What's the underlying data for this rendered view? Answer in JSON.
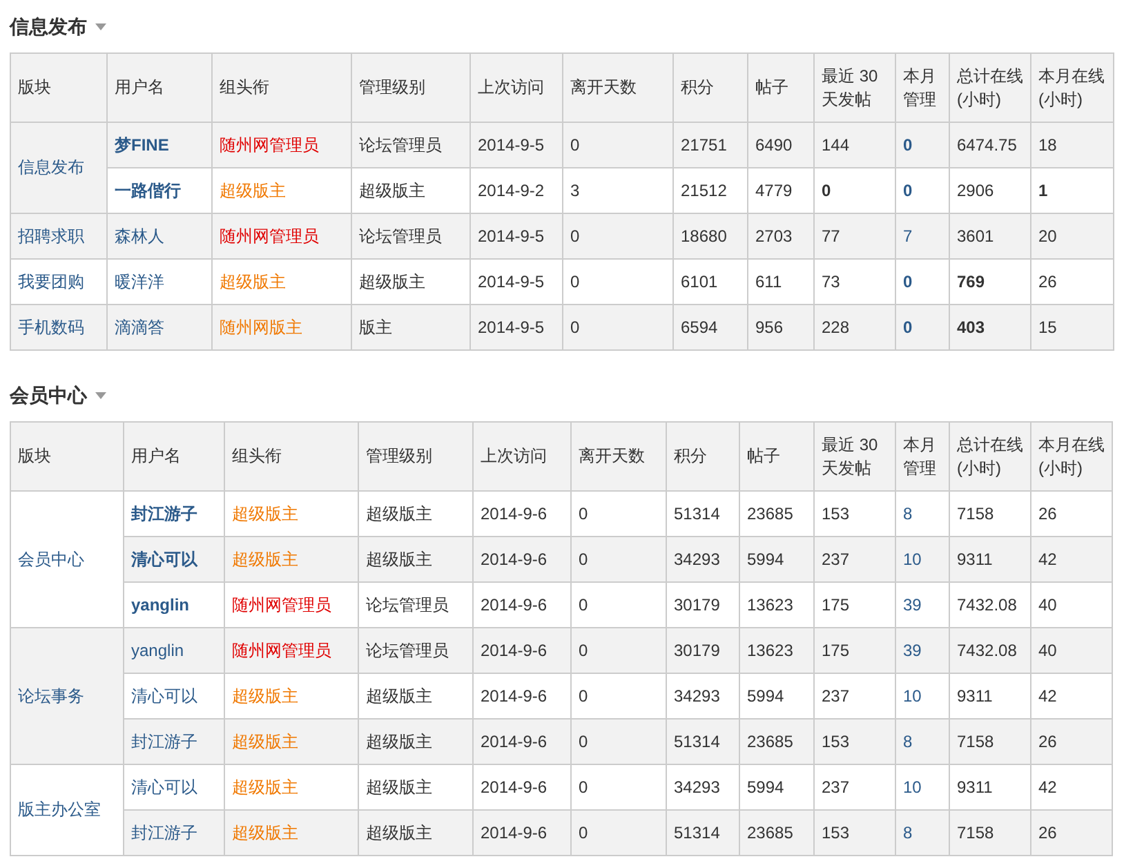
{
  "sections": [
    {
      "title": "信息发布",
      "columns": [
        "版块",
        "用户名",
        "组头衔",
        "管理级别",
        "上次访问",
        "离开天数",
        "积分",
        "帖子",
        "最近 30 天发帖",
        "本月管理",
        "总计在线(小时)",
        "本月在线(小时)"
      ],
      "groups": [
        {
          "forum": "信息发布",
          "rows": [
            {
              "shaded": true,
              "user": {
                "text": "梦FINE",
                "bold": true
              },
              "title": {
                "text": "随州网管理员",
                "color": "#e00000"
              },
              "level": "论坛管理员",
              "last_visit": "2014-9-5",
              "days_away": "0",
              "points": "21751",
              "posts": "6490",
              "recent_posts": {
                "text": "144",
                "bold": false
              },
              "month_manage": {
                "text": "0",
                "bold": true
              },
              "total_online": {
                "text": "6474.75",
                "bold": false
              },
              "month_online": {
                "text": "18",
                "bold": false
              }
            },
            {
              "shaded": false,
              "user": {
                "text": "一路偕行",
                "bold": true
              },
              "title": {
                "text": "超级版主",
                "color": "#f07800"
              },
              "level": "超级版主",
              "last_visit": "2014-9-2",
              "days_away": "3",
              "points": "21512",
              "posts": "4779",
              "recent_posts": {
                "text": "0",
                "bold": true
              },
              "month_manage": {
                "text": "0",
                "bold": true
              },
              "total_online": {
                "text": "2906",
                "bold": false
              },
              "month_online": {
                "text": "1",
                "bold": true
              }
            }
          ]
        },
        {
          "forum": "招聘求职",
          "rows": [
            {
              "shaded": true,
              "user": {
                "text": "森林人",
                "bold": false
              },
              "title": {
                "text": "随州网管理员",
                "color": "#e00000"
              },
              "level": "论坛管理员",
              "last_visit": "2014-9-5",
              "days_away": "0",
              "points": "18680",
              "posts": "2703",
              "recent_posts": {
                "text": "77",
                "bold": false
              },
              "month_manage": {
                "text": "7",
                "bold": false
              },
              "total_online": {
                "text": "3601",
                "bold": false
              },
              "month_online": {
                "text": "20",
                "bold": false
              }
            }
          ]
        },
        {
          "forum": "我要团购",
          "rows": [
            {
              "shaded": false,
              "user": {
                "text": "暖洋洋",
                "bold": false
              },
              "title": {
                "text": "超级版主",
                "color": "#f07800"
              },
              "level": "超级版主",
              "last_visit": "2014-9-5",
              "days_away": "0",
              "points": "6101",
              "posts": "611",
              "recent_posts": {
                "text": "73",
                "bold": false
              },
              "month_manage": {
                "text": "0",
                "bold": true
              },
              "total_online": {
                "text": "769",
                "bold": true
              },
              "month_online": {
                "text": "26",
                "bold": false
              }
            }
          ]
        },
        {
          "forum": "手机数码",
          "rows": [
            {
              "shaded": true,
              "user": {
                "text": "滴滴答",
                "bold": false
              },
              "title": {
                "text": "随州网版主",
                "color": "#f07800"
              },
              "level": "版主",
              "last_visit": "2014-9-5",
              "days_away": "0",
              "points": "6594",
              "posts": "956",
              "recent_posts": {
                "text": "228",
                "bold": false
              },
              "month_manage": {
                "text": "0",
                "bold": true
              },
              "total_online": {
                "text": "403",
                "bold": true
              },
              "month_online": {
                "text": "15",
                "bold": false
              }
            }
          ]
        }
      ]
    },
    {
      "title": "会员中心",
      "columns": [
        "版块",
        "用户名",
        "组头衔",
        "管理级别",
        "上次访问",
        "离开天数",
        "积分",
        "帖子",
        "最近 30 天发帖",
        "本月管理",
        "总计在线(小时)",
        "本月在线(小时)"
      ],
      "groups": [
        {
          "forum": "会员中心",
          "rows": [
            {
              "shaded": false,
              "user": {
                "text": "封江游子",
                "bold": true
              },
              "title": {
                "text": "超级版主",
                "color": "#f07800"
              },
              "level": "超级版主",
              "last_visit": "2014-9-6",
              "days_away": "0",
              "points": "51314",
              "posts": "23685",
              "recent_posts": {
                "text": "153",
                "bold": false
              },
              "month_manage": {
                "text": "8",
                "bold": false
              },
              "total_online": {
                "text": "7158",
                "bold": false
              },
              "month_online": {
                "text": "26",
                "bold": false
              }
            },
            {
              "shaded": true,
              "user": {
                "text": "清心可以",
                "bold": true
              },
              "title": {
                "text": "超级版主",
                "color": "#f07800"
              },
              "level": "超级版主",
              "last_visit": "2014-9-6",
              "days_away": "0",
              "points": "34293",
              "posts": "5994",
              "recent_posts": {
                "text": "237",
                "bold": false
              },
              "month_manage": {
                "text": "10",
                "bold": false
              },
              "total_online": {
                "text": "9311",
                "bold": false
              },
              "month_online": {
                "text": "42",
                "bold": false
              }
            },
            {
              "shaded": false,
              "user": {
                "text": "yanglin",
                "bold": true
              },
              "title": {
                "text": "随州网管理员",
                "color": "#e00000"
              },
              "level": "论坛管理员",
              "last_visit": "2014-9-6",
              "days_away": "0",
              "points": "30179",
              "posts": "13623",
              "recent_posts": {
                "text": "175",
                "bold": false
              },
              "month_manage": {
                "text": "39",
                "bold": false
              },
              "total_online": {
                "text": "7432.08",
                "bold": false
              },
              "month_online": {
                "text": "40",
                "bold": false
              }
            }
          ]
        },
        {
          "forum": "论坛事务",
          "rows": [
            {
              "shaded": true,
              "user": {
                "text": "yanglin",
                "bold": false
              },
              "title": {
                "text": "随州网管理员",
                "color": "#e00000"
              },
              "level": "论坛管理员",
              "last_visit": "2014-9-6",
              "days_away": "0",
              "points": "30179",
              "posts": "13623",
              "recent_posts": {
                "text": "175",
                "bold": false
              },
              "month_manage": {
                "text": "39",
                "bold": false
              },
              "total_online": {
                "text": "7432.08",
                "bold": false
              },
              "month_online": {
                "text": "40",
                "bold": false
              }
            },
            {
              "shaded": false,
              "user": {
                "text": "清心可以",
                "bold": false
              },
              "title": {
                "text": "超级版主",
                "color": "#f07800"
              },
              "level": "超级版主",
              "last_visit": "2014-9-6",
              "days_away": "0",
              "points": "34293",
              "posts": "5994",
              "recent_posts": {
                "text": "237",
                "bold": false
              },
              "month_manage": {
                "text": "10",
                "bold": false
              },
              "total_online": {
                "text": "9311",
                "bold": false
              },
              "month_online": {
                "text": "42",
                "bold": false
              }
            },
            {
              "shaded": true,
              "user": {
                "text": "封江游子",
                "bold": false
              },
              "title": {
                "text": "超级版主",
                "color": "#f07800"
              },
              "level": "超级版主",
              "last_visit": "2014-9-6",
              "days_away": "0",
              "points": "51314",
              "posts": "23685",
              "recent_posts": {
                "text": "153",
                "bold": false
              },
              "month_manage": {
                "text": "8",
                "bold": false
              },
              "total_online": {
                "text": "7158",
                "bold": false
              },
              "month_online": {
                "text": "26",
                "bold": false
              }
            }
          ]
        },
        {
          "forum": "版主办公室",
          "rows": [
            {
              "shaded": false,
              "user": {
                "text": "清心可以",
                "bold": false
              },
              "title": {
                "text": "超级版主",
                "color": "#f07800"
              },
              "level": "超级版主",
              "last_visit": "2014-9-6",
              "days_away": "0",
              "points": "34293",
              "posts": "5994",
              "recent_posts": {
                "text": "237",
                "bold": false
              },
              "month_manage": {
                "text": "10",
                "bold": false
              },
              "total_online": {
                "text": "9311",
                "bold": false
              },
              "month_online": {
                "text": "42",
                "bold": false
              }
            },
            {
              "shaded": true,
              "user": {
                "text": "封江游子",
                "bold": false
              },
              "title": {
                "text": "超级版主",
                "color": "#f07800"
              },
              "level": "超级版主",
              "last_visit": "2014-9-6",
              "days_away": "0",
              "points": "51314",
              "posts": "23685",
              "recent_posts": {
                "text": "153",
                "bold": false
              },
              "month_manage": {
                "text": "8",
                "bold": false
              },
              "total_online": {
                "text": "7158",
                "bold": false
              },
              "month_online": {
                "text": "26",
                "bold": false
              }
            }
          ]
        }
      ]
    }
  ]
}
